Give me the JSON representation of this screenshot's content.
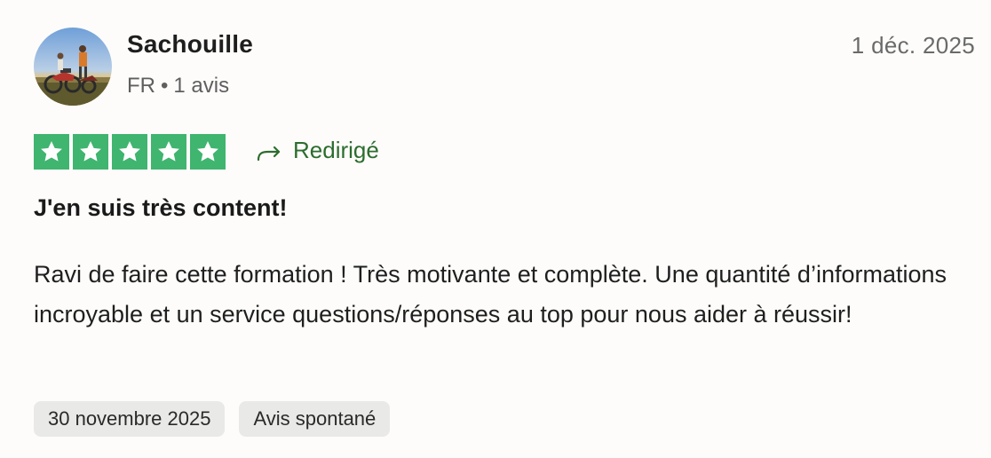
{
  "review": {
    "author": {
      "name": "Sachouille",
      "country": "FR",
      "separator": "•",
      "review_count": "1 avis",
      "avatar_icon": "avatar-photo-icon"
    },
    "date": "1 déc. 2025",
    "rating": {
      "value": 5,
      "max": 5,
      "star_color": "#3fb56f"
    },
    "redirect_label": "Redirigé",
    "redirect_icon": "redirect-arrow-icon",
    "redirect_color": "#2c6d2e",
    "title": "J'en suis très content!",
    "body": "Ravi de faire cette formation ! Très motivante et complète. Une quantité d’informations incroyable et un service questions/réponses au top pour nous aider à réussir!",
    "tags": [
      {
        "label": "30 novembre 2025"
      },
      {
        "label": "Avis spontané"
      }
    ]
  }
}
